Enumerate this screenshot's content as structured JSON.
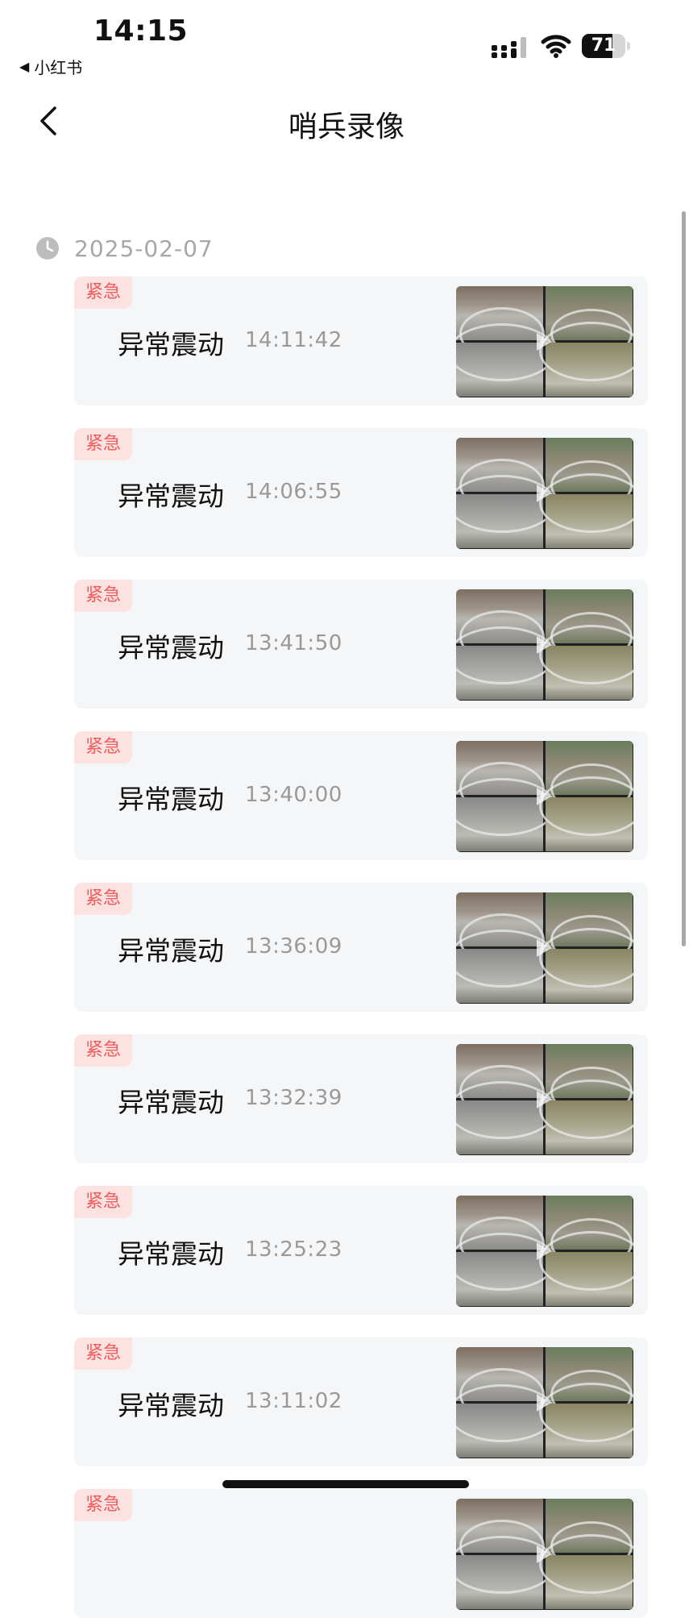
{
  "status_bar": {
    "time": "14:15",
    "back_app_label": "小红书",
    "battery_level": "71",
    "battery_fraction": 0.71
  },
  "nav": {
    "title": "哨兵录像"
  },
  "date": "2025-02-07",
  "records": [
    {
      "tag": "紧急",
      "event": "异常震动",
      "time": "14:11:42"
    },
    {
      "tag": "紧急",
      "event": "异常震动",
      "time": "14:06:55"
    },
    {
      "tag": "紧急",
      "event": "异常震动",
      "time": "13:41:50"
    },
    {
      "tag": "紧急",
      "event": "异常震动",
      "time": "13:40:00"
    },
    {
      "tag": "紧急",
      "event": "异常震动",
      "time": "13:36:09"
    },
    {
      "tag": "紧急",
      "event": "异常震动",
      "time": "13:32:39"
    },
    {
      "tag": "紧急",
      "event": "异常震动",
      "time": "13:25:23"
    },
    {
      "tag": "紧急",
      "event": "异常震动",
      "time": "13:11:02"
    },
    {
      "tag": "紧急",
      "event": "",
      "time": ""
    }
  ],
  "colors": {
    "tag_bg": "#fde2e2",
    "tag_text": "#ee5d5d",
    "card_bg": "#f5f6f8",
    "secondary_text": "#999999"
  },
  "icons": {
    "back": "chevron-left-icon",
    "date": "clock-icon",
    "thumbnail": "play-icon"
  }
}
